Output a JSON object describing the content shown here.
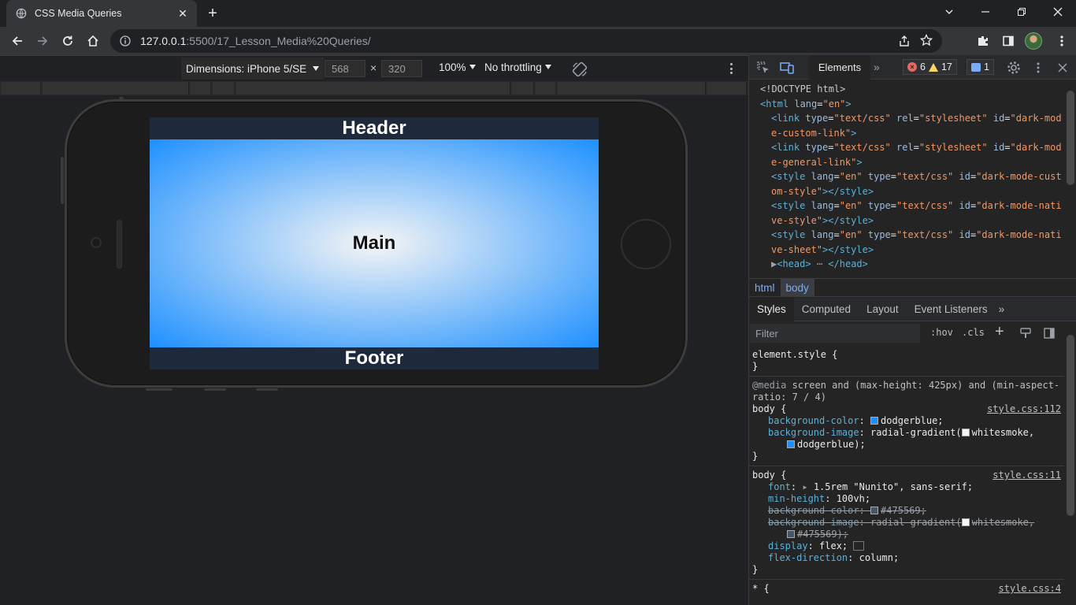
{
  "browser": {
    "tab_title": "CSS Media Queries",
    "url_host": "127.0.0.1",
    "url_path": ":5500/17_Lesson_Media%20Queries/"
  },
  "device_toolbar": {
    "dimensions_label": "Dimensions: iPhone 5/SE",
    "width": "568",
    "height": "320",
    "times": "×",
    "zoom": "100%",
    "throttling": "No throttling"
  },
  "page": {
    "header": "Header",
    "main": "Main",
    "footer": "Footer"
  },
  "devtools": {
    "active_tab": "Elements",
    "errors": "6",
    "warnings": "17",
    "messages": "1",
    "dom_lines": [
      {
        "indent": 1,
        "html": "<span class='doct'>&lt;!DOCTYPE html&gt;</span>"
      },
      {
        "indent": 1,
        "html": "<span class='tag'>&lt;html</span> <span class='attr'>lang</span>=<span class='val'>\"en\"</span><span class='tag'>&gt;</span>"
      },
      {
        "indent": 2,
        "html": "<span class='tag'>&lt;link</span> <span class='attr'>type</span>=<span class='val'>\"text/css\"</span> <span class='attr'>rel</span>=<span class='val'>\"stylesheet\"</span> <span class='attr'>id</span>=<span class='val'>\"dark-mod</span>"
      },
      {
        "indent": 2,
        "html": "<span class='val'>e-custom-link\"</span><span class='tag'>&gt;</span>"
      },
      {
        "indent": 2,
        "html": "<span class='tag'>&lt;link</span> <span class='attr'>type</span>=<span class='val'>\"text/css\"</span> <span class='attr'>rel</span>=<span class='val'>\"stylesheet\"</span> <span class='attr'>id</span>=<span class='val'>\"dark-mod</span>"
      },
      {
        "indent": 2,
        "html": "<span class='val'>e-general-link\"</span><span class='tag'>&gt;</span>"
      },
      {
        "indent": 2,
        "html": "<span class='tag'>&lt;style</span> <span class='attr'>lang</span>=<span class='val'>\"en\"</span> <span class='attr'>type</span>=<span class='val'>\"text/css\"</span> <span class='attr'>id</span>=<span class='val'>\"dark-mode-cust</span>"
      },
      {
        "indent": 2,
        "html": "<span class='val'>om-style\"</span><span class='tag'>&gt;&lt;/style&gt;</span>"
      },
      {
        "indent": 2,
        "html": "<span class='tag'>&lt;style</span> <span class='attr'>lang</span>=<span class='val'>\"en\"</span> <span class='attr'>type</span>=<span class='val'>\"text/css\"</span> <span class='attr'>id</span>=<span class='val'>\"dark-mode-nati</span>"
      },
      {
        "indent": 2,
        "html": "<span class='val'>ve-style\"</span><span class='tag'>&gt;&lt;/style&gt;</span>"
      },
      {
        "indent": 2,
        "html": "<span class='tag'>&lt;style</span> <span class='attr'>lang</span>=<span class='val'>\"en\"</span> <span class='attr'>type</span>=<span class='val'>\"text/css\"</span> <span class='attr'>id</span>=<span class='val'>\"dark-mode-nati</span>"
      },
      {
        "indent": 2,
        "html": "<span class='val'>ve-sheet\"</span><span class='tag'>&gt;&lt;/style&gt;</span>"
      },
      {
        "indent": 2,
        "html": "<span style='color:#9aa0a6'>▶</span><span class='tag'>&lt;head&gt;</span> <span style='color:#9aa0a6'>⋯</span> <span class='tag'>&lt;/head&gt;</span>"
      }
    ],
    "breadcrumbs": [
      "html",
      "body"
    ],
    "styles_tabs": [
      "Styles",
      "Computed",
      "Layout",
      "Event Listeners"
    ],
    "filter_placeholder": "Filter",
    "hov": ":hov",
    "cls": ".cls"
  },
  "colors": {
    "dodgerblue": "#1e90ff",
    "whitesmoke": "#f5f5f5",
    "slate": "#475569"
  }
}
